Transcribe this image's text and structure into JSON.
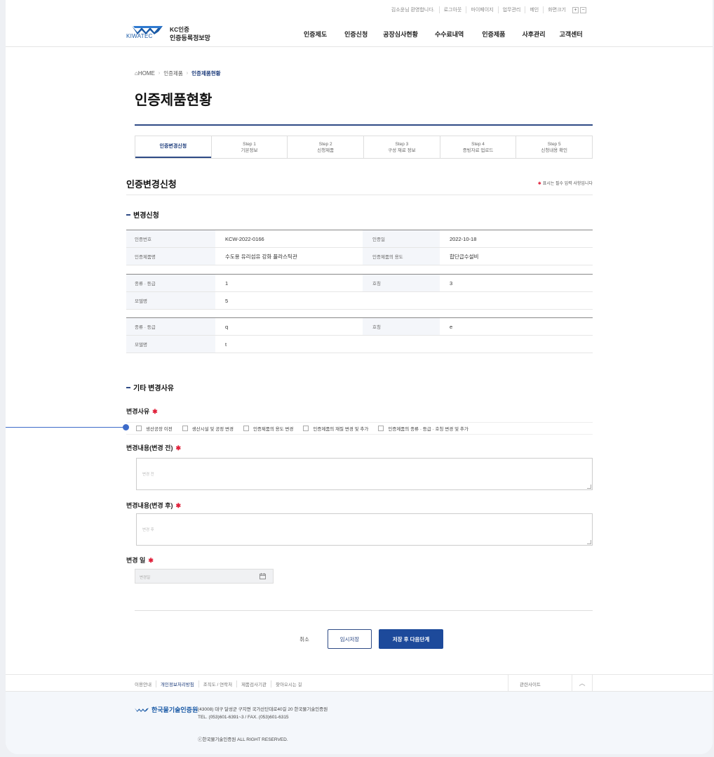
{
  "util": {
    "greeting": "김소윤님 환영합니다.",
    "links": [
      "로그아웃",
      "마이페이지",
      "업무관리",
      "메인",
      "화면크기"
    ],
    "font_plus": "+",
    "font_minus": "−"
  },
  "logo": {
    "brand": "KIWATEC",
    "line1": "KC인증",
    "line2": "인증등록정보망"
  },
  "gnb": [
    "인증제도",
    "인증신청",
    "공장심사현황",
    "수수료내역",
    "인증제품",
    "사후관리",
    "고객센터"
  ],
  "breadcrumb": {
    "home": "HOME",
    "level1": "인증제품",
    "current": "인증제품현황"
  },
  "page_title": "인증제품현황",
  "steps": [
    {
      "label": "인증변경신청",
      "sub": ""
    },
    {
      "label": "Step 1",
      "sub": "기본정보"
    },
    {
      "label": "Step 2",
      "sub": "신청제품"
    },
    {
      "label": "Step 3",
      "sub": "구성 재료 정보"
    },
    {
      "label": "Step 4",
      "sub": "증빙자료 업로드"
    },
    {
      "label": "Step 5",
      "sub": "신청내용 확인"
    }
  ],
  "section_title": "인증변경신청",
  "required_note": "표시는 필수 입력 사항입니다",
  "change_request": {
    "heading": "변경신청",
    "cert_no_label": "인증번호",
    "cert_no": "KCW-2022-0166",
    "cert_date_label": "인증일",
    "cert_date": "2022-10-18",
    "product_name_label": "인증제품명",
    "product_name": "수도용 유리섬유 강화 플라스틱관",
    "usage_label": "인증제품의 용도",
    "usage": "합단급수설비",
    "group1": {
      "type_label": "종류 · 등급",
      "type": "1",
      "size_label": "호칭",
      "size": "3",
      "model_label": "모델명",
      "model": "5"
    },
    "group2": {
      "type_label": "종류 · 등급",
      "type": "q",
      "size_label": "호칭",
      "size": "e",
      "model_label": "모델명",
      "model": "t"
    }
  },
  "other_reason": {
    "heading": "기타 변경사유",
    "reason_label": "변경사유",
    "options": [
      "생산공장 이전",
      "생산시설 및 공정 변경",
      "인증제품의 용도 변경",
      "인증제품의 재질 변경 및 추가",
      "인증제품의 종류 · 등급 · 호칭 변경 및 추가"
    ],
    "before_label": "변경내용(변경 전)",
    "before_placeholder": "변경 전",
    "after_label": "변경내용(변경 후)",
    "after_placeholder": "변경 후",
    "date_label": "변경 일",
    "date_placeholder": "변경일"
  },
  "buttons": {
    "cancel": "취소",
    "temp_save": "임시저장",
    "save_next": "저장 후 다음단계"
  },
  "footer": {
    "links": [
      "이용안내",
      "개인정보처리방침",
      "조직도 / 연락처",
      "제품검사기관",
      "찾아오시는 길"
    ],
    "family_site": "관련사이트",
    "to_top": "︿",
    "org_name": "한국물기술인증원",
    "address": "(43008) 대구 달성군 구지면 국가산단대로40길 20 한국물기술인증원",
    "tel": "TEL. (053)601-6391~3 / FAX. (053)601-6315",
    "copyright": "ⓒ한국물기술인증원 ALL RIGHT RESERVED."
  },
  "colors": {
    "primary": "#1d4a9b",
    "accent_red": "#e0203a",
    "callout": "#3d6bc9"
  }
}
